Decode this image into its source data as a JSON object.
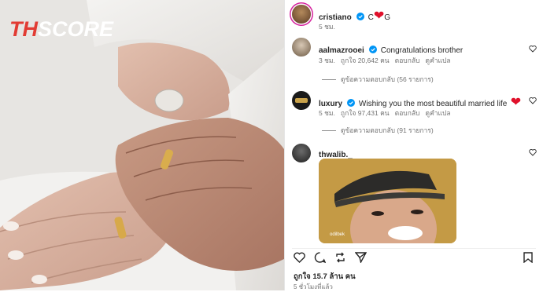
{
  "logo": {
    "th": "TH",
    "score": "SCORE"
  },
  "post": {
    "author": "cristiano",
    "caption_prefix": "C",
    "caption_suffix": "G",
    "time": "5 ชม."
  },
  "comments": [
    {
      "username": "aalmazrooei",
      "text": "Congratulations brother",
      "time": "3 ชม.",
      "likes": "ถูกใจ 20,642 คน",
      "reply": "ตอบกลับ",
      "translate": "ดูคำแปล",
      "view_replies": "ดูข้อความตอบกลับ (56 รายการ)"
    },
    {
      "username": "luxury",
      "text": "Wishing you the most beautiful married life",
      "time": "5 ชม.",
      "likes": "ถูกใจ 97,431 คน",
      "reply": "ตอบกลับ",
      "translate": "ดูคำแปล",
      "view_replies": "ดูข้อความตอบกลับ (91 รายการ)"
    },
    {
      "username": "thwalib._",
      "gif_watermark": "odilbek"
    }
  ],
  "footer": {
    "likes": "ถูกใจ 15.7 ล้าน คน",
    "ago": "5 ชั่วโมงที่แล้ว"
  },
  "colors": {
    "verified": "#0095f6",
    "heart": "#e0112b",
    "logo_red": "#e23b33"
  }
}
